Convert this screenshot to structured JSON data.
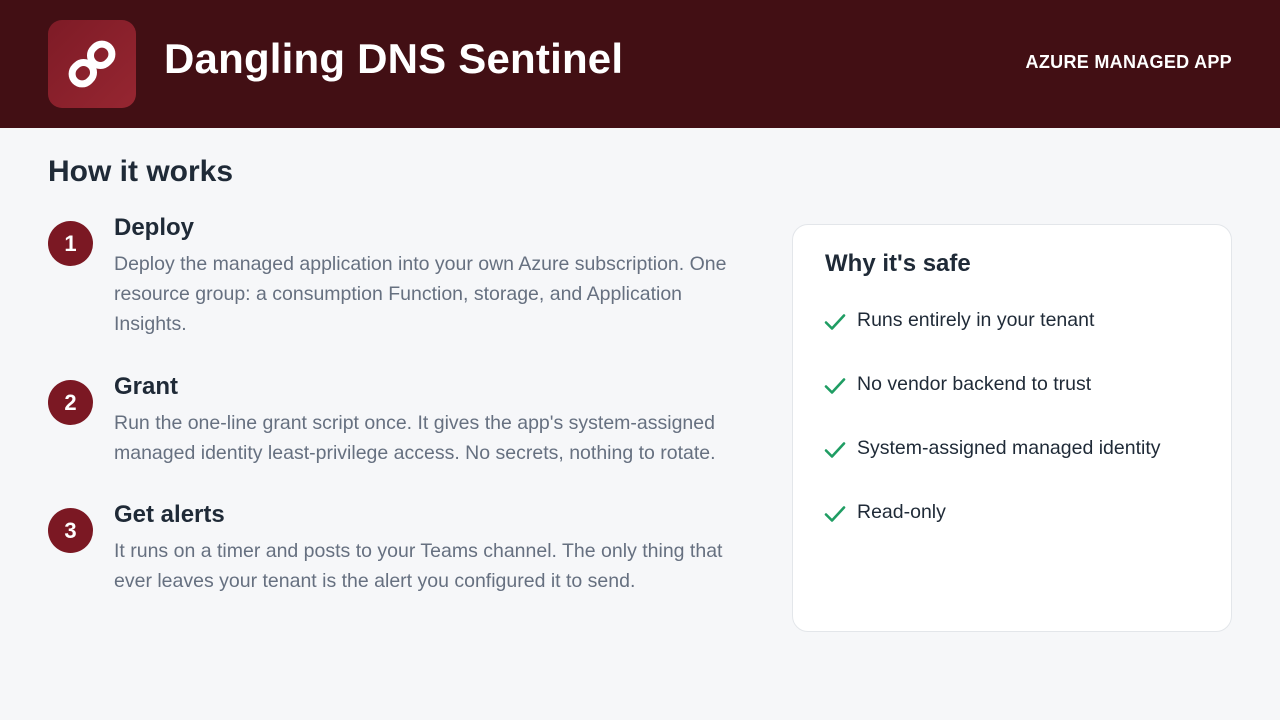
{
  "header": {
    "title": "Dangling DNS Sentinel",
    "tag": "AZURE MANAGED APP",
    "icon": "link-icon",
    "background_color": "#420f14",
    "icon_color": "#8a2030"
  },
  "main": {
    "section_title": "How it works",
    "steps": [
      {
        "number": "1",
        "title": "Deploy",
        "description": "Deploy the managed application into your own Azure subscription. One resource group: a consumption Function, storage, and Application Insights."
      },
      {
        "number": "2",
        "title": "Grant",
        "description": "Run the one-line grant script once. It gives the app's system-assigned managed identity least-privilege access. No secrets, nothing to rotate."
      },
      {
        "number": "3",
        "title": "Get alerts",
        "description": "It runs on a timer and posts to your Teams channel. The only thing that ever leaves your tenant is the alert you configured it to send."
      }
    ]
  },
  "safety": {
    "title": "Why it's safe",
    "check_color": "#1f9d63",
    "items": [
      "Runs entirely in your tenant",
      "No vendor backend to trust",
      "System-assigned managed identity",
      "Read-only"
    ]
  }
}
